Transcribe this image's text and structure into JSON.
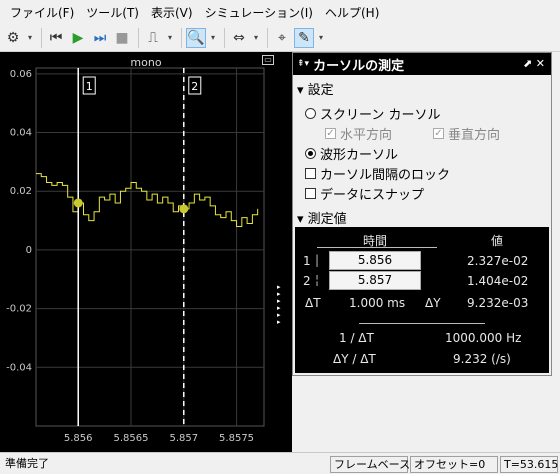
{
  "menu": [
    "ファイル(F)",
    "ツール(T)",
    "表示(V)",
    "シミュレーション(I)",
    "ヘルプ(H)"
  ],
  "toolbar_icons": [
    "gear-icon",
    "chevron-down-icon",
    "rewind-icon",
    "run-icon",
    "step-forward-icon",
    "stop-icon",
    "trigger-icon",
    "chevron-down-icon",
    "zoom-in-icon",
    "chevron-down-icon",
    "fit-icon",
    "chevron-down-icon",
    "cursor-icon",
    "highlight-icon",
    "chevron-down-icon"
  ],
  "scope": {
    "title": "mono",
    "cursor1_label": "1",
    "cursor2_label": "2",
    "bg": "#000000",
    "signal_color": "#e6e63c",
    "cursor_marker_color": "#c8c832"
  },
  "chart_data": {
    "type": "line",
    "title": "mono",
    "xlabel": "",
    "ylabel": "",
    "xlim": [
      5.8556,
      5.85776
    ],
    "ylim": [
      -0.06,
      0.062
    ],
    "xticks": [
      "5.856",
      "5.8565",
      "5.857",
      "5.8575"
    ],
    "yticks": [
      "0.06",
      "0.04",
      "0.02",
      "0",
      "-0.02",
      "-0.04"
    ],
    "grid": true,
    "series": [
      {
        "x": [
          5.8556,
          5.85565,
          5.8557,
          5.85575,
          5.8558,
          5.85585,
          5.8559,
          5.85595,
          5.856,
          5.85605,
          5.8561,
          5.85615,
          5.8562,
          5.85625,
          5.8563,
          5.85635,
          5.8564,
          5.85645,
          5.8565,
          5.85655,
          5.8566,
          5.85665,
          5.8567,
          5.85675,
          5.8568,
          5.85685,
          5.8569,
          5.85695,
          5.857,
          5.85705,
          5.8571,
          5.85715,
          5.8572,
          5.85725,
          5.8573,
          5.85735,
          5.8574,
          5.85745,
          5.8575,
          5.85755,
          5.8576,
          5.85765,
          5.8577
        ],
        "y": [
          0.026,
          0.025,
          0.023,
          0.022,
          0.023,
          0.022,
          0.018,
          0.013,
          0.016,
          0.012,
          0.01,
          0.013,
          0.018,
          0.017,
          0.019,
          0.016,
          0.02,
          0.021,
          0.023,
          0.021,
          0.02,
          0.017,
          0.019,
          0.016,
          0.018,
          0.016,
          0.013,
          0.015,
          0.014,
          0.016,
          0.019,
          0.017,
          0.018,
          0.015,
          0.012,
          0.011,
          0.013,
          0.01,
          0.008,
          0.011,
          0.009,
          0.012,
          0.014
        ]
      }
    ],
    "cursors": [
      5.856,
      5.857
    ]
  },
  "side_arrows": [
    "▸",
    "▸",
    "▸",
    "▸",
    "▸",
    "▸"
  ],
  "panel": {
    "title": "カーソルの測定",
    "settings_header": "設定",
    "screen_cursor": "スクリーン カーソル",
    "horizontal": "水平方向",
    "vertical": "垂直方向",
    "waveform_cursor": "波形カーソル",
    "lock_spacing": "カーソル間隔のロック",
    "snap_to_data": "データにスナップ",
    "measurements_header": "測定値",
    "col_time": "時間",
    "col_value": "値",
    "row1_label": "1",
    "row1_time": "5.856",
    "row1_value": "2.327e-02",
    "row2_label": "2",
    "row2_time": "5.857",
    "row2_value": "1.404e-02",
    "delta_t_label": "ΔT",
    "delta_t_value": "1.000 ms",
    "delta_y_label": "ΔY",
    "delta_y_value": "9.232e-03",
    "inv_dt_label": "1 / ΔT",
    "inv_dt_value": "1000.000 Hz",
    "dy_dt_label": "ΔY / ΔT",
    "dy_dt_value": "9.232 (/s)"
  },
  "status": {
    "left": "準備完了",
    "mode": "フレームベース",
    "offset": "オフセット=0",
    "time": "T=53.615"
  }
}
